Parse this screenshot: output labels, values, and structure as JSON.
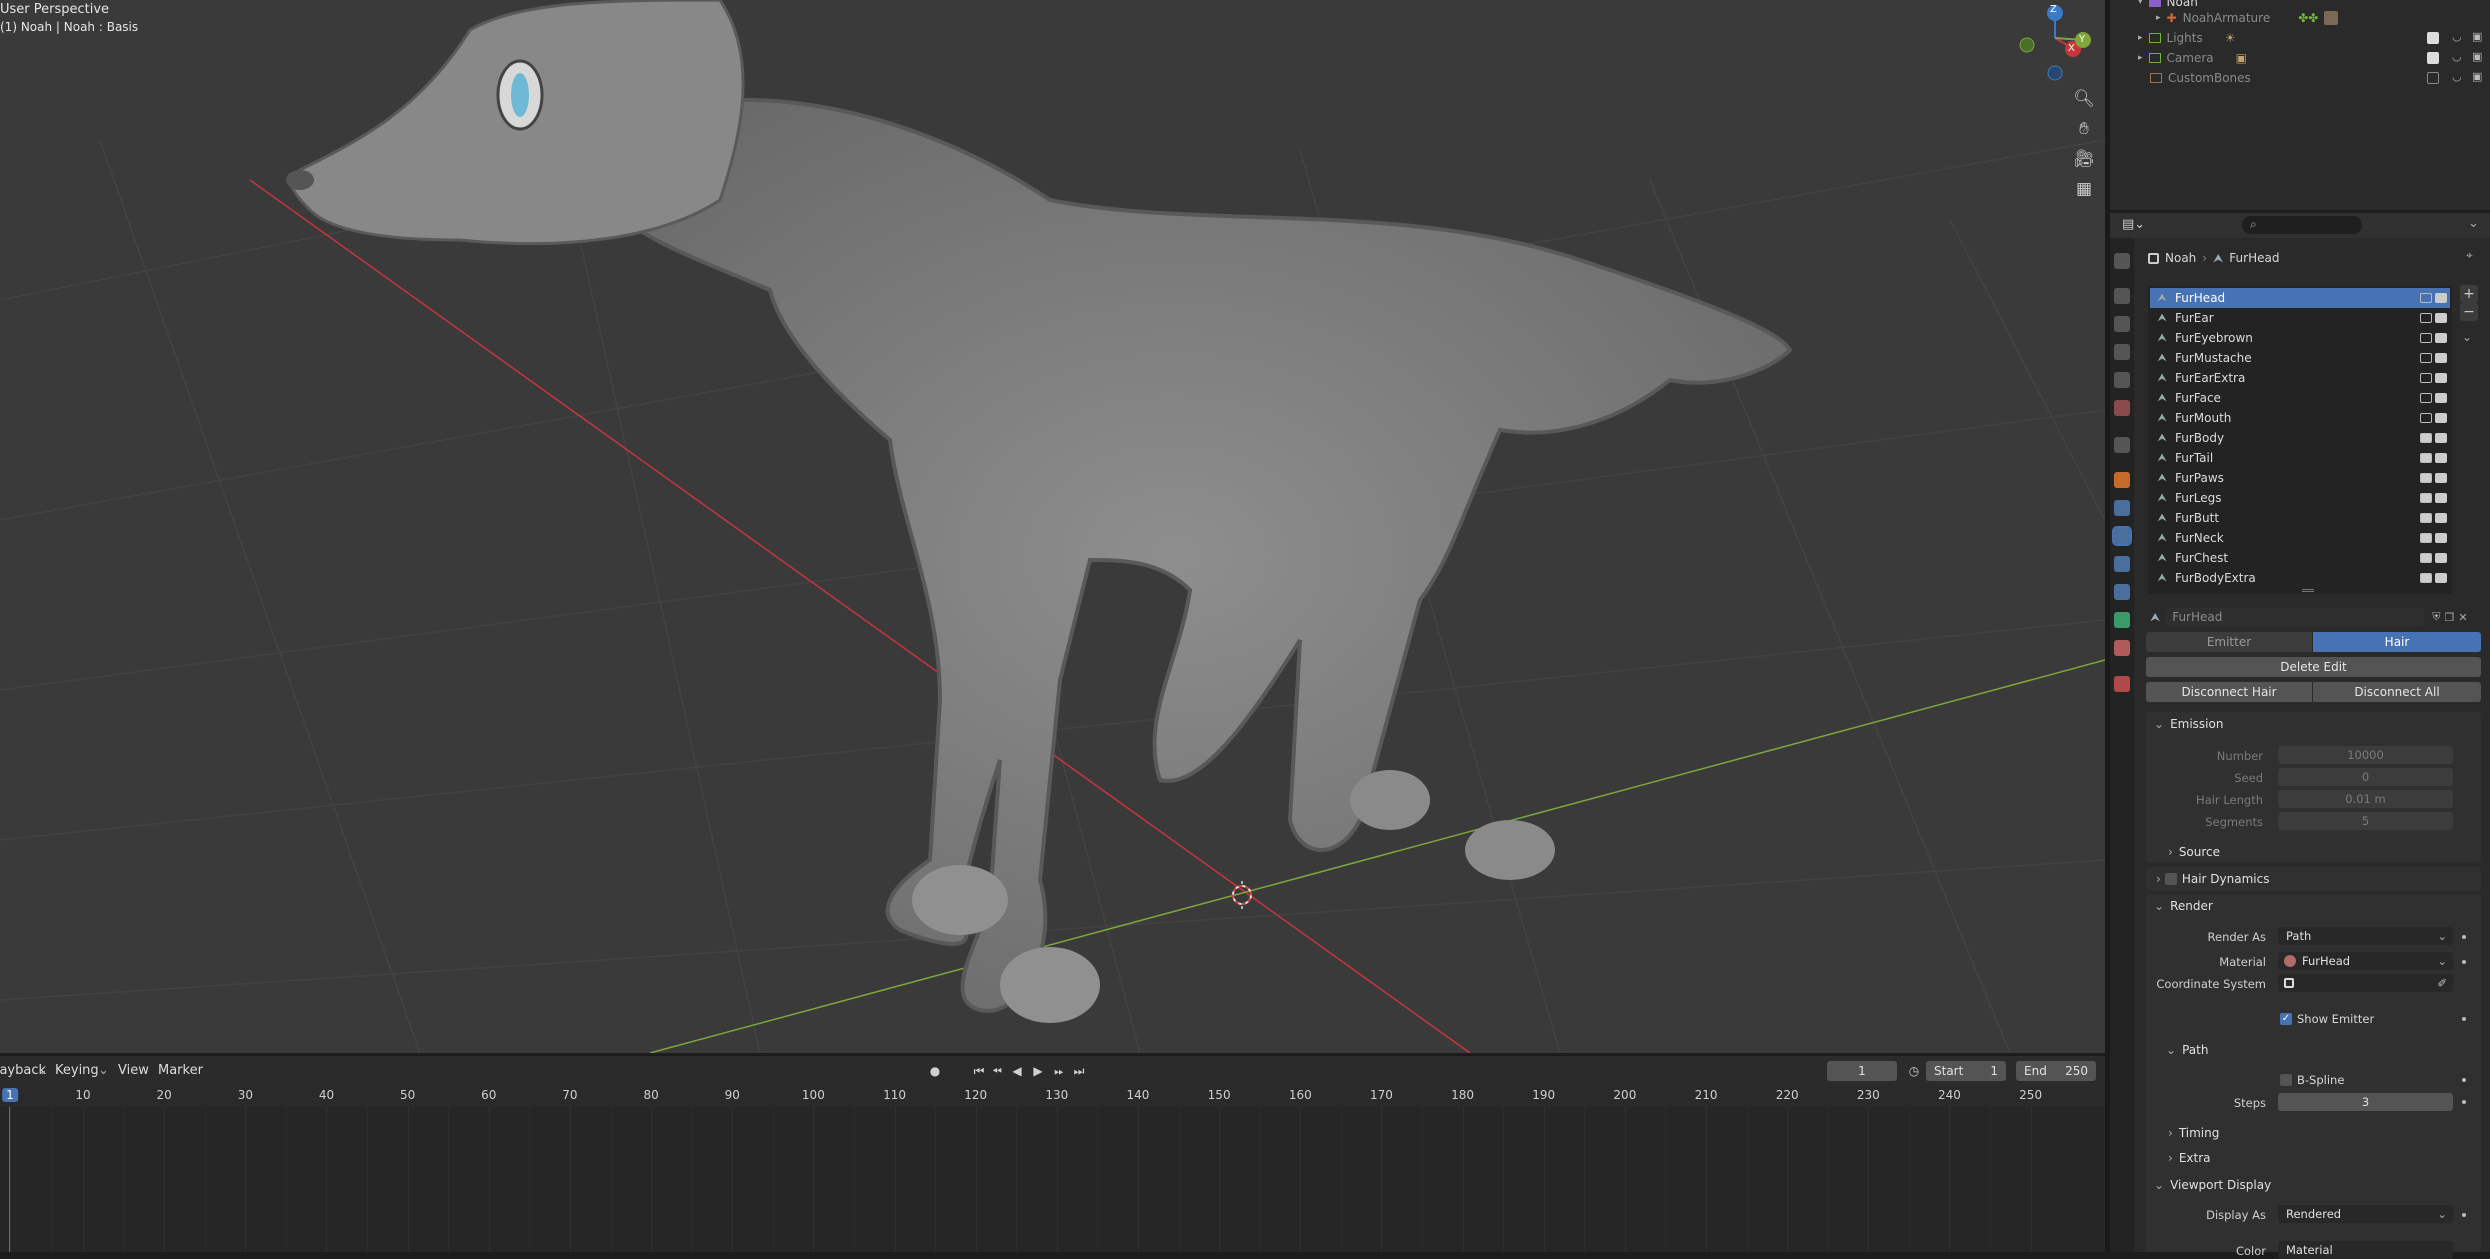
{
  "viewport": {
    "title": "User Perspective",
    "subtitle": "(1) Noah | Noah : Basis",
    "gizmo": {
      "z": "Z",
      "y": "Y",
      "x": "X"
    }
  },
  "timeline": {
    "menus": [
      "Playback",
      "Keying",
      "View",
      "Marker"
    ],
    "current_frame": "1",
    "start_label": "Start",
    "start_value": "1",
    "end_label": "End",
    "end_value": "250",
    "ticks": [
      "1",
      "10",
      "20",
      "30",
      "40",
      "50",
      "60",
      "70",
      "80",
      "90",
      "100",
      "110",
      "120",
      "130",
      "140",
      "150",
      "160",
      "170",
      "180",
      "190",
      "200",
      "210",
      "220",
      "230",
      "240",
      "250"
    ]
  },
  "outliner": {
    "rows": [
      {
        "label": "Noah",
        "indent": 1
      },
      {
        "label": "NoahArmature",
        "indent": 2
      },
      {
        "label": "Lights",
        "indent": 1
      },
      {
        "label": "Camera",
        "indent": 1
      },
      {
        "label": "CustomBones",
        "indent": 1
      }
    ]
  },
  "properties": {
    "breadcrumb": [
      "Noah",
      "FurHead"
    ],
    "particle_systems": [
      "FurHead",
      "FurEar",
      "FurEyebrown",
      "FurMustache",
      "FurEarExtra",
      "FurFace",
      "FurMouth",
      "FurBody",
      "FurTail",
      "FurPaws",
      "FurLegs",
      "FurButt",
      "FurNeck",
      "FurChest",
      "FurBodyExtra"
    ],
    "selected_system": "FurHead",
    "settings_name": "FurHead",
    "type_tabs": [
      "Emitter",
      "Hair"
    ],
    "active_type": "Hair",
    "delete_edit": "Delete Edit",
    "disconnect_hair": "Disconnect Hair",
    "disconnect_all": "Disconnect All",
    "emission": {
      "header": "Emission",
      "number_label": "Number",
      "number": "10000",
      "seed_label": "Seed",
      "seed": "0",
      "hair_length_label": "Hair Length",
      "hair_length": "0.01 m",
      "segments_label": "Segments",
      "segments": "5"
    },
    "source_header": "Source",
    "hair_dynamics_header": "Hair Dynamics",
    "render": {
      "header": "Render",
      "render_as_label": "Render As",
      "render_as": "Path",
      "material_label": "Material",
      "material": "FurHead",
      "coord_label": "Coordinate System",
      "show_emitter": "Show Emitter"
    },
    "path": {
      "header": "Path",
      "bspline": "B-Spline",
      "steps_label": "Steps",
      "steps": "3"
    },
    "timing_header": "Timing",
    "extra_header": "Extra",
    "viewport_display": {
      "header": "Viewport Display",
      "display_as_label": "Display As",
      "display_as": "Rendered",
      "color_label": "Color",
      "color": "Material"
    }
  },
  "colors": {
    "accent": "#4772b3",
    "background": "#3a3a3a",
    "x_axis": "#c8363c",
    "y_axis": "#7ea63a"
  }
}
